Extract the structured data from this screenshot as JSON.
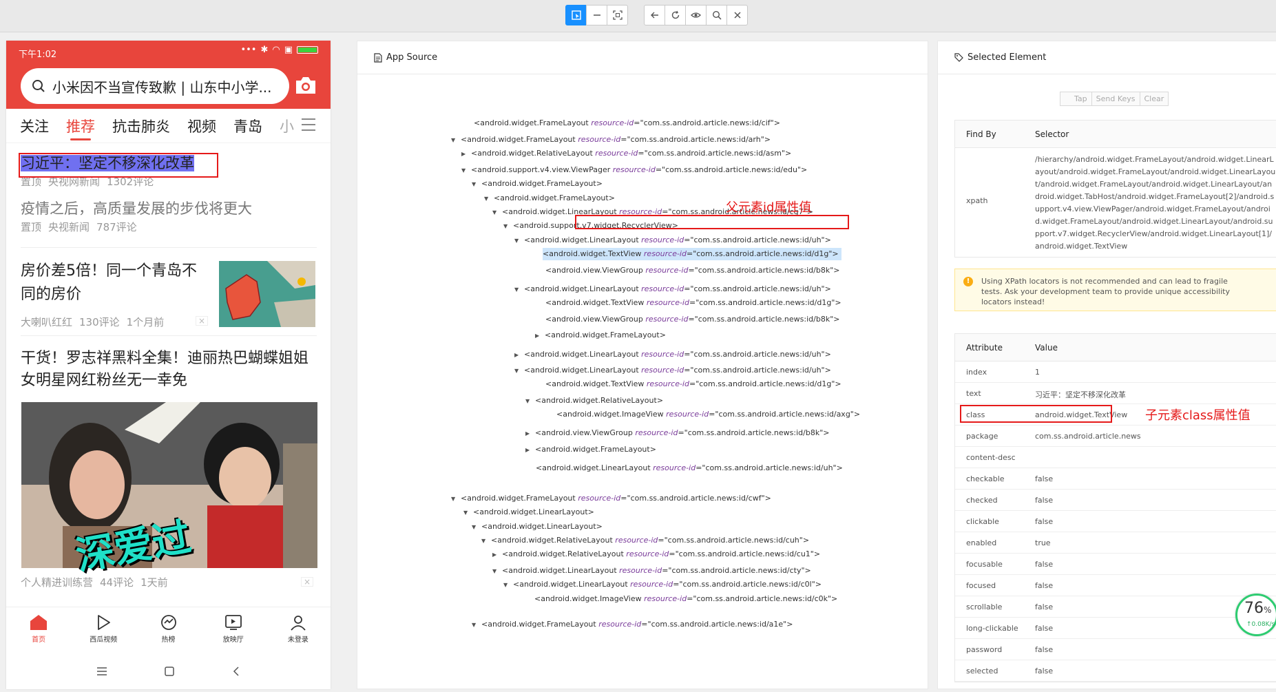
{
  "toolbar": {
    "left_buttons": [
      "select-icon",
      "swipe-icon",
      "screenshot-icon"
    ],
    "right_buttons": [
      "back-icon",
      "refresh-icon",
      "eye-icon",
      "search-icon",
      "close-icon"
    ]
  },
  "phone": {
    "status_time": "下午1:02",
    "search_text": "小米因不当宣传致歉 | 山东中小学...",
    "channels": [
      "关注",
      "推荐",
      "抗击肺炎",
      "视频",
      "青岛",
      "小"
    ],
    "active_channel": "推荐",
    "news": [
      {
        "title": "习近平：坚定不移深化改革",
        "meta": [
          "置顶",
          "央视网新闻",
          "1302评论"
        ]
      },
      {
        "title": "疫情之后，高质量发展的步伐将更大",
        "meta": [
          "置顶",
          "央视新闻",
          "787评论"
        ]
      },
      {
        "title": "房价差5倍！同一个青岛不同的房价",
        "meta": [
          "大喇叭红红",
          "130评论",
          "1个月前"
        ]
      },
      {
        "title": "干货！罗志祥黑料全集！迪丽热巴蝴蝶姐姐女明星网红粉丝无一幸免",
        "meta": [
          "个人精进训练营",
          "44评论",
          "1天前"
        ]
      }
    ],
    "image_text": "深爱过",
    "bottom_nav": [
      "首页",
      "西瓜视频",
      "热榜",
      "放映厅",
      "未登录"
    ]
  },
  "annotations": {
    "parent_label": "父元素id属性值",
    "child_label": "子元素class属性值"
  },
  "source": {
    "title": "App Source",
    "nodes": [
      {
        "tag": "android.widget.FrameLayout",
        "rid": "com.ss.android.article.news:id/cif",
        "arrow": ""
      },
      {
        "tag": "android.widget.FrameLayout",
        "rid": "com.ss.android.article.news:id/arh",
        "arrow": "▼"
      },
      {
        "tag": "android.widget.RelativeLayout",
        "rid": "com.ss.android.article.news:id/asm",
        "arrow": "▶"
      },
      {
        "tag": "android.support.v4.view.ViewPager",
        "rid": "com.ss.android.article.news:id/edu",
        "arrow": "▼"
      },
      {
        "tag": "android.widget.FrameLayout",
        "rid": "",
        "arrow": "▼"
      },
      {
        "tag": "android.widget.FrameLayout",
        "rid": "",
        "arrow": "▼"
      },
      {
        "tag": "android.widget.LinearLayout",
        "rid": "com.ss.android.article.news:id/cg7",
        "arrow": "▼"
      },
      {
        "tag": "android.support.v7.widget.RecyclerView",
        "rid": "",
        "arrow": "▼"
      },
      {
        "tag": "android.widget.LinearLayout",
        "rid": "com.ss.android.article.news:id/uh",
        "arrow": "▼"
      },
      {
        "tag": "android.widget.TextView",
        "rid": "com.ss.android.article.news:id/d1g",
        "arrow": ""
      },
      {
        "tag": "android.view.ViewGroup",
        "rid": "com.ss.android.article.news:id/b8k",
        "arrow": ""
      },
      {
        "tag": "android.widget.LinearLayout",
        "rid": "com.ss.android.article.news:id/uh",
        "arrow": "▼"
      },
      {
        "tag": "android.widget.TextView",
        "rid": "com.ss.android.article.news:id/d1g",
        "arrow": ""
      },
      {
        "tag": "android.view.ViewGroup",
        "rid": "com.ss.android.article.news:id/b8k",
        "arrow": ""
      },
      {
        "tag": "android.widget.FrameLayout",
        "rid": "",
        "arrow": "▶"
      },
      {
        "tag": "android.widget.LinearLayout",
        "rid": "com.ss.android.article.news:id/uh",
        "arrow": "▶"
      },
      {
        "tag": "android.widget.LinearLayout",
        "rid": "com.ss.android.article.news:id/uh",
        "arrow": "▼"
      },
      {
        "tag": "android.widget.TextView",
        "rid": "com.ss.android.article.news:id/d1g",
        "arrow": ""
      },
      {
        "tag": "android.widget.RelativeLayout",
        "rid": "",
        "arrow": "▼"
      },
      {
        "tag": "android.widget.ImageView",
        "rid": "com.ss.android.article.news:id/axg",
        "arrow": ""
      },
      {
        "tag": "android.view.ViewGroup",
        "rid": "com.ss.android.article.news:id/b8k",
        "arrow": "▶"
      },
      {
        "tag": "android.widget.FrameLayout",
        "rid": "",
        "arrow": "▶"
      },
      {
        "tag": "android.widget.LinearLayout",
        "rid": "com.ss.android.article.news:id/uh",
        "arrow": ""
      },
      {
        "tag": "android.widget.FrameLayout",
        "rid": "com.ss.android.article.news:id/cwf",
        "arrow": "▼"
      },
      {
        "tag": "android.widget.LinearLayout",
        "rid": "",
        "arrow": "▼"
      },
      {
        "tag": "android.widget.LinearLayout",
        "rid": "",
        "arrow": "▼"
      },
      {
        "tag": "android.widget.RelativeLayout",
        "rid": "com.ss.android.article.news:id/cuh",
        "arrow": "▼"
      },
      {
        "tag": "android.widget.RelativeLayout",
        "rid": "com.ss.android.article.news:id/cu1",
        "arrow": "▶"
      },
      {
        "tag": "android.widget.LinearLayout",
        "rid": "com.ss.android.article.news:id/cty",
        "arrow": "▼"
      },
      {
        "tag": "android.widget.LinearLayout",
        "rid": "com.ss.android.article.news:id/c0l",
        "arrow": "▼"
      },
      {
        "tag": "android.widget.ImageView",
        "rid": "com.ss.android.article.news:id/c0k",
        "arrow": ""
      },
      {
        "tag": "android.widget.FrameLayout",
        "rid": "com.ss.android.article.news:id/a1e",
        "arrow": "▼"
      }
    ]
  },
  "selected": {
    "title": "Selected Element",
    "buttons": [
      "Tap",
      "Send Keys",
      "Clear"
    ],
    "find_by_header": "Find By",
    "selector_header": "Selector",
    "find_by": "xpath",
    "selector": "/hierarchy/android.widget.FrameLayout/android.widget.LinearLayout/android.widget.FrameLayout/android.widget.LinearLayout/android.widget.FrameLayout/android.widget.LinearLayout/android.widget.TabHost/android.widget.FrameLayout[2]/android.support.v4.view.ViewPager/android.widget.FrameLayout/android.widget.FrameLayout/android.widget.LinearLayout/android.support.v7.widget.RecyclerView/android.widget.LinearLayout[1]/android.widget.TextView",
    "warning": "Using XPath locators is not recommended and can lead to fragile tests. Ask your development team to provide unique accessibility locators instead!",
    "attr_header": "Attribute",
    "value_header": "Value",
    "attributes": [
      {
        "name": "index",
        "value": "1"
      },
      {
        "name": "text",
        "value": "习近平：坚定不移深化改革"
      },
      {
        "name": "class",
        "value": "android.widget.TextView"
      },
      {
        "name": "package",
        "value": "com.ss.android.article.news"
      },
      {
        "name": "content-desc",
        "value": ""
      },
      {
        "name": "checkable",
        "value": "false"
      },
      {
        "name": "checked",
        "value": "false"
      },
      {
        "name": "clickable",
        "value": "false"
      },
      {
        "name": "enabled",
        "value": "true"
      },
      {
        "name": "focusable",
        "value": "false"
      },
      {
        "name": "focused",
        "value": "false"
      },
      {
        "name": "scrollable",
        "value": "false"
      },
      {
        "name": "long-clickable",
        "value": "false"
      },
      {
        "name": "password",
        "value": "false"
      },
      {
        "name": "selected",
        "value": "false"
      }
    ]
  },
  "gauge": {
    "percent": "76",
    "unit": "%",
    "speed": "↑0.08K/s"
  },
  "colors": {
    "accent": "#1890ff",
    "brand_red": "#e8453c",
    "annotation_red": "#e51919"
  }
}
